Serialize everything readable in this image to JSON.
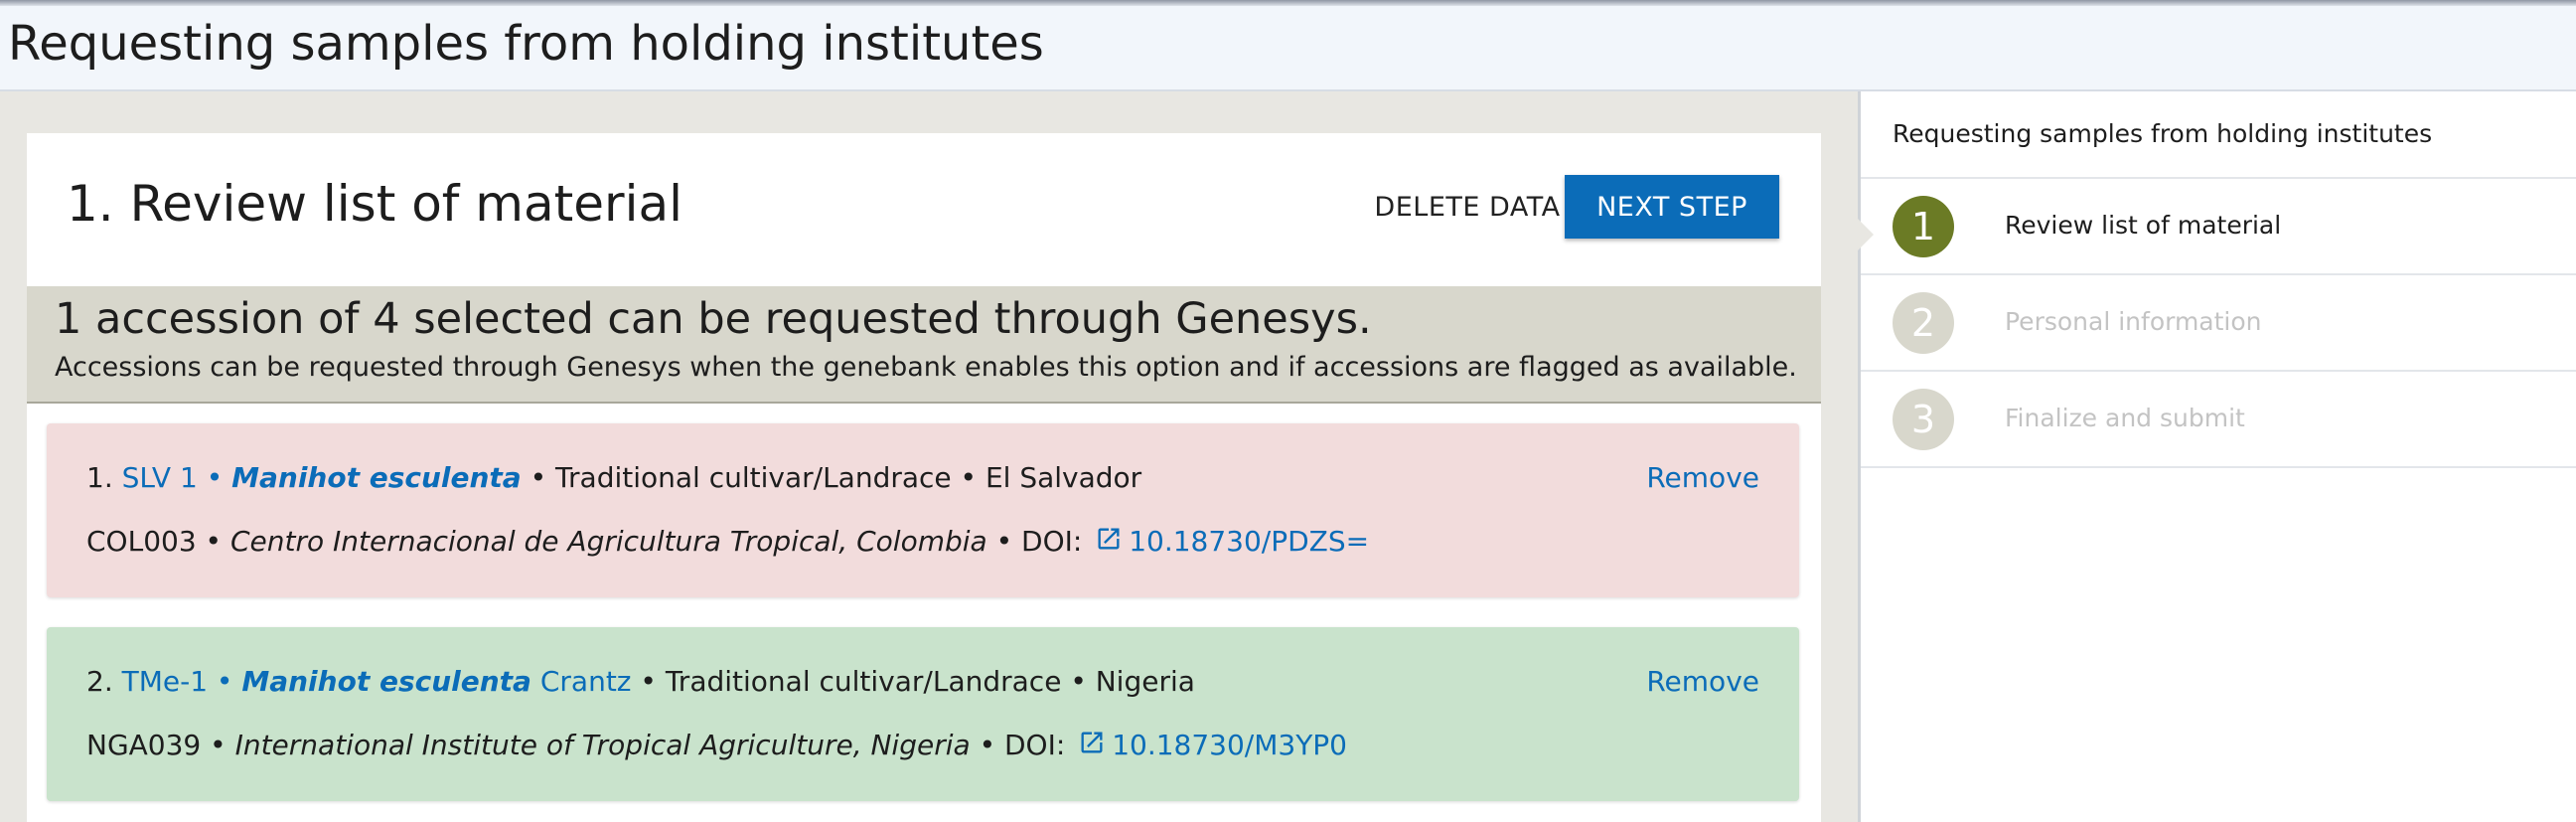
{
  "page": {
    "title": "Requesting samples from holding institutes"
  },
  "step": {
    "title": "1. Review list of material",
    "delete_label": "DELETE DATA",
    "next_label": "NEXT STEP"
  },
  "summary": {
    "heading": "1 accession of 4 selected can be requested through Genesys.",
    "text": "Accessions can be requested through Genesys when the genebank enables this option and if accessions are flagged as available."
  },
  "items": [
    {
      "number": "1.",
      "accession": "SLV 1",
      "sep": " • ",
      "species": "Manihot esculenta",
      "author": "",
      "details": " • Traditional cultivar/Landrace • El Salvador",
      "inst_code": "COL003 • ",
      "institute": "Centro Internacional de Agricultura Tropical, Colombia",
      "doi_label": " • DOI:",
      "doi": "10.18730/PDZS=",
      "remove_label": "Remove",
      "status_color": "#f2dcdc"
    },
    {
      "number": "2.",
      "accession": "TMe-1",
      "sep": " • ",
      "species": "Manihot esculenta",
      "author": " Crantz",
      "details": " • Traditional cultivar/Landrace • Nigeria",
      "inst_code": "NGA039 • ",
      "institute": "International Institute of Tropical Agriculture, Nigeria",
      "doi_label": " • DOI:",
      "doi": "10.18730/M3YP0",
      "remove_label": "Remove",
      "status_color": "#c9e3cc"
    }
  ],
  "sidebar": {
    "title": "Requesting samples from holding institutes",
    "steps": [
      {
        "num": "1",
        "label": "Review list of material",
        "state": "active",
        "circle_color": "#6b7b25",
        "label_color": "#1d1d1d"
      },
      {
        "num": "2",
        "label": "Personal information",
        "state": "inactive",
        "circle_color": "#d8d7cc",
        "label_color": "#c3c3c3"
      },
      {
        "num": "3",
        "label": "Finalize and submit",
        "state": "inactive",
        "circle_color": "#d8d7cc",
        "label_color": "#c3c3c3"
      }
    ]
  },
  "colors": {
    "accent": "#0b6cb8",
    "active_step": "#6b7b25"
  }
}
